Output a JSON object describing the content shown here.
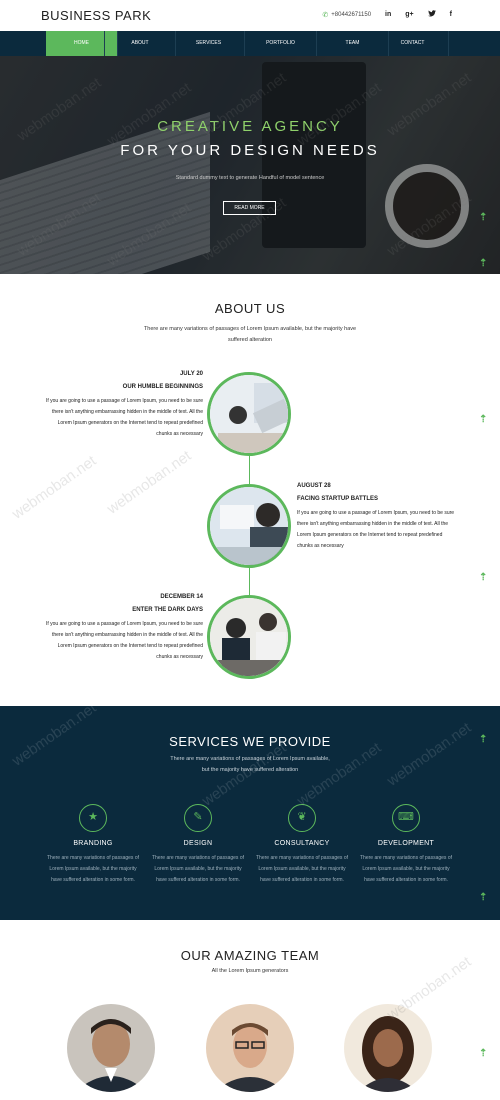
{
  "header": {
    "brand": "BUSINESS PARK",
    "phone": "+80442671150",
    "social": [
      "in",
      "g+",
      "t",
      "f"
    ]
  },
  "nav": {
    "items": [
      "HOME",
      "ABOUT",
      "SERVICES",
      "PORTFOLIO",
      "TEAM",
      "CONTACT"
    ],
    "active": "HOME"
  },
  "hero": {
    "line1": "CREATIVE AGENCY",
    "line2": "FOR YOUR DESIGN NEEDS",
    "sub": "Standard dummy text to generate Handful of model sentence",
    "button": "READ MORE"
  },
  "about": {
    "title": "ABOUT US",
    "desc1": "There are many variations of passages of Lorem Ipsum available, but the majority have",
    "desc2": "suffered alteration",
    "events": [
      {
        "date": "JULY 20",
        "title": "OUR HUMBLE BEGINNINGS",
        "text": "If you are going to use a passage of Lorem Ipsum, you need to be sure there isn't anything embarrassing hidden in the middle of text. All the Lorem Ipsum generators on the Internet tend to repeat predefined chunks as necessary"
      },
      {
        "date": "AUGUST 28",
        "title": "FACING STARTUP BATTLES",
        "text": "If you are going to use a passage of Lorem Ipsum, you need to be sure there isn't anything embarrassing hidden in the middle of text. All the Lorem Ipsum generators on the Internet tend to repeat predefined chunks as necessary"
      },
      {
        "date": "DECEMBER 14",
        "title": "ENTER THE DARK DAYS",
        "text": "If you are going to use a passage of Lorem Ipsum, you need to be sure there isn't anything embarrassing hidden in the middle of text. All the Lorem Ipsum generators on the Internet tend to repeat predefined chunks as necessary"
      }
    ]
  },
  "services": {
    "title": "SERVICES WE PROVIDE",
    "desc1": "There are many variations of passages of Lorem Ipsum available,",
    "desc2": "but the majority have suffered alteration",
    "items": [
      {
        "name": "BRANDING",
        "icon": "star-icon",
        "text": "There are many variations of passages of Lorem Ipsum available, but the majority have suffered alteration in some form."
      },
      {
        "name": "DESIGN",
        "icon": "pencil-icon",
        "text": "There are many variations of passages of Lorem Ipsum available, but the majority have suffered alteration in some form."
      },
      {
        "name": "CONSULTANCY",
        "icon": "handshake-icon",
        "text": "There are many variations of passages of Lorem Ipsum available, but the majority have suffered alteration in some form."
      },
      {
        "name": "DEVELOPMENT",
        "icon": "code-icon",
        "text": "There are many variations of passages of Lorem Ipsum available, but the majority have suffered alteration in some form."
      }
    ]
  },
  "team": {
    "title": "OUR AMAZING TEAM",
    "sub": "All the Lorem Ipsum generators"
  },
  "watermark": "webmoban.net",
  "colors": {
    "accent": "#5cb85c",
    "dark": "#0b2a3d"
  }
}
